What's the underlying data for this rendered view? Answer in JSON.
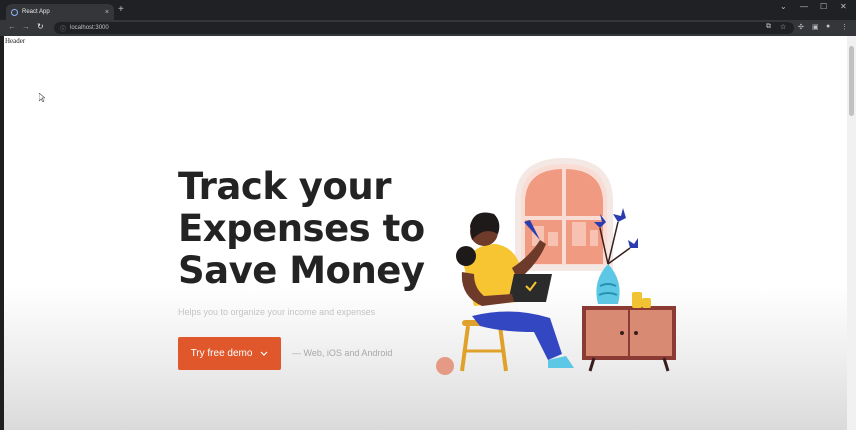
{
  "browser": {
    "tab_title": "React App",
    "tab_close": "×",
    "new_tab": "+",
    "url": "localhost:3000",
    "win_minimize": "—",
    "win_maximize": "☐",
    "win_close": "✕",
    "tab_search": "⌄"
  },
  "page": {
    "header_text": "Header",
    "hero_title_lines": [
      "Track your",
      "Expenses to",
      "Save Money"
    ],
    "hero_subtitle": "Helps you to organize your income and expenses",
    "demo_button_label": "Try free demo",
    "platforms_text": "— Web, iOS and Android"
  },
  "colors": {
    "accent": "#e0572b",
    "title": "#232323"
  }
}
